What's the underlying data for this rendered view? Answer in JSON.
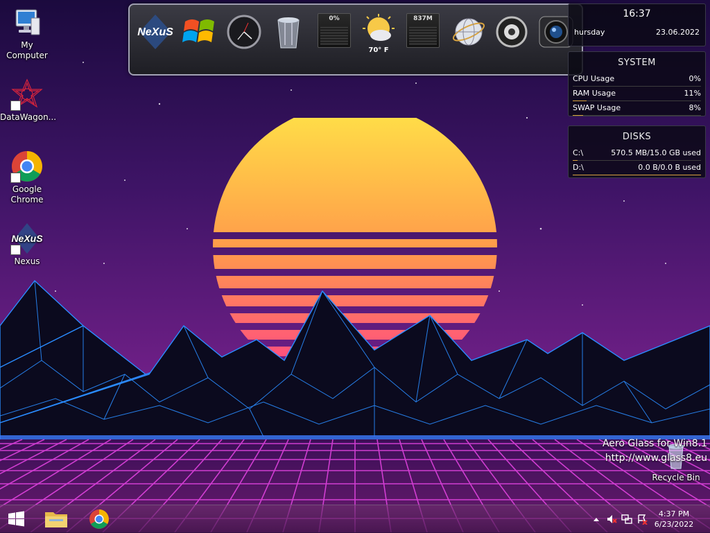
{
  "desktop": {
    "icons": [
      {
        "label": "My Computer",
        "icon": "computer-icon"
      },
      {
        "label": "DataWagon...",
        "icon": "datawagon-icon"
      },
      {
        "label": "Google Chrome",
        "icon": "chrome-icon"
      },
      {
        "label": "Nexus",
        "icon": "nexus-icon"
      },
      {
        "label": "Recycle Bin",
        "icon": "recycle-bin-icon"
      }
    ]
  },
  "dock": {
    "nexus_logo": "NeXuS",
    "items": [
      "nexus-logo-icon",
      "windows-logo-icon",
      "clock-icon",
      "trash-icon",
      "cpu-meter-icon",
      "weather-icon",
      "memory-meter-icon",
      "network-globe-icon",
      "speaker-icon",
      "camera-icon"
    ],
    "cpu_meter_value": "0%",
    "weather_temp": "70° F",
    "memory_meter_value": "837M"
  },
  "clock_gadget": {
    "time": "16:37",
    "day": "hursday",
    "date": "23.06.2022"
  },
  "system_gadget": {
    "title": "SYSTEM",
    "rows": [
      {
        "label": "CPU Usage",
        "value": "0%",
        "fill": 0.0
      },
      {
        "label": "RAM Usage",
        "value": "11%",
        "fill": 0.11
      },
      {
        "label": "SWAP Usage",
        "value": "8%",
        "fill": 0.08
      }
    ]
  },
  "disks_gadget": {
    "title": "DISKS",
    "rows": [
      {
        "label": "C:\\",
        "value": "570.5 MB/15.0 GB used",
        "fill": 0.04
      },
      {
        "label": "D:\\",
        "value": "0.0 B/0.0 B used",
        "fill": 1.0
      }
    ]
  },
  "watermark": {
    "line1": "Aero Glass for Win8.1",
    "line2": "http://www.glass8.eu"
  },
  "taskbar": {
    "time": "4:37 PM",
    "date": "6/23/2022"
  },
  "colors": {
    "sun_top": "#ffe347",
    "sun_bottom": "#ff3d8b",
    "grid": "#e845e6",
    "mountain_line": "#2a8cff",
    "sky_top": "#2a0f52",
    "sky_mid": "#5a1c7c"
  }
}
